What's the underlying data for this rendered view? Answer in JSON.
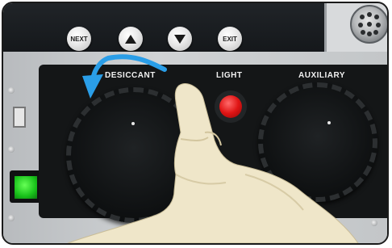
{
  "nav_buttons": {
    "next_label": "NEXT",
    "up_icon": "triangle-up-icon",
    "down_icon": "triangle-down-icon",
    "exit_label": "EXIT"
  },
  "panel_labels": {
    "desiccant": "DESICCANT",
    "light": "LIGHT",
    "auxiliary": "AUXILIARY"
  },
  "colors": {
    "arrow": "#2a9ee8",
    "light_button": "#e01515",
    "power_switch": "#19c21b",
    "glove": "#efe6c9"
  },
  "annotations": {
    "arrow_direction": "counter-clockwise"
  }
}
